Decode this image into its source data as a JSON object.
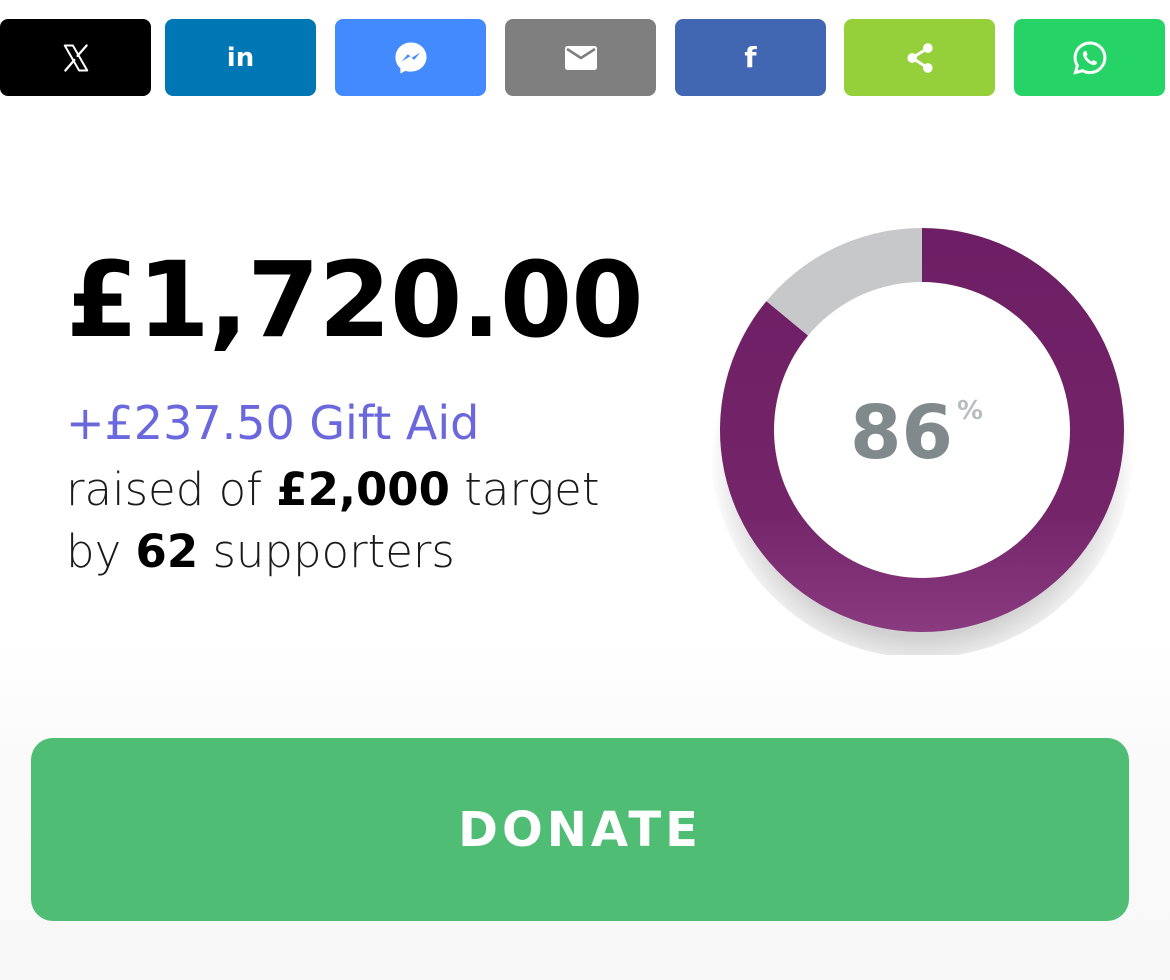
{
  "share": {
    "buttons": [
      {
        "name": "x",
        "icon": "x-logo-icon",
        "color": "#000000"
      },
      {
        "name": "linkedin",
        "icon": "linkedin-icon",
        "label": "in",
        "color": "#0077b5"
      },
      {
        "name": "messenger",
        "icon": "messenger-icon",
        "color": "#448aff"
      },
      {
        "name": "email",
        "icon": "email-icon",
        "color": "#7f7f7f"
      },
      {
        "name": "facebook",
        "icon": "facebook-icon",
        "label": "f",
        "color": "#4267b2"
      },
      {
        "name": "share",
        "icon": "share-icon",
        "color": "#95d03a"
      },
      {
        "name": "whatsapp",
        "icon": "whatsapp-icon",
        "color": "#25d366"
      }
    ]
  },
  "fundraising": {
    "amount_raised": "£1,720.00",
    "gift_aid": "+£237.50 Gift Aid",
    "raised_prefix": "raised of",
    "target": "£2,000",
    "target_suffix": "target",
    "by_prefix": "by",
    "supporters_count": "62",
    "supporters_suffix": "supporters",
    "progress_percent": "86",
    "progress_fraction": 0.86,
    "percent_sign": "%",
    "ring_color": "#732066",
    "ring_remaining_color": "#c7c8ca"
  },
  "donate": {
    "label": "DONATE",
    "color": "#50bd74"
  }
}
